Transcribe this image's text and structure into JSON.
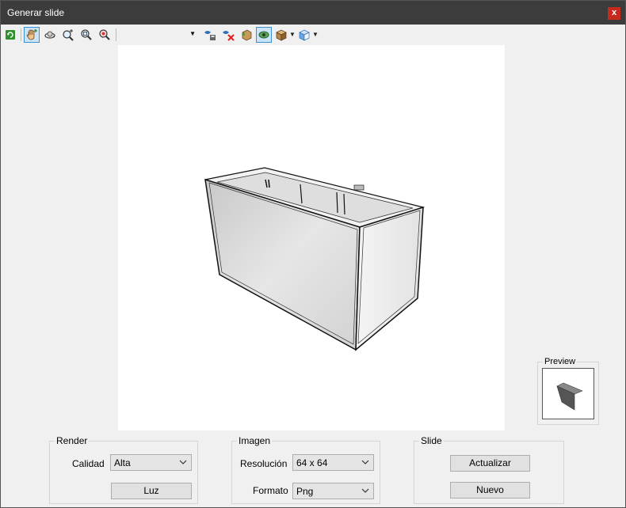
{
  "window": {
    "title": "Generar slide",
    "close_label": "x"
  },
  "toolbar": {
    "view_combo_value": "",
    "icons": [
      "refresh-icon",
      "pan-hand-icon",
      "orbit-icon",
      "zoom-in-icon",
      "zoom-window-icon",
      "zoom-extents-icon",
      "save-view-icon",
      "delete-view-icon",
      "shading-icon",
      "hidden-line-icon",
      "render-style-icon",
      "view-direction-icon"
    ]
  },
  "preview": {
    "label": "Preview"
  },
  "render": {
    "legend": "Render",
    "quality_label": "Calidad",
    "quality_value": "Alta",
    "light_button": "Luz"
  },
  "image": {
    "legend": "Imagen",
    "resolution_label": "Resolución",
    "resolution_value": "64 x 64",
    "format_label": "Formato",
    "format_value": "Png"
  },
  "slide": {
    "legend": "Slide",
    "update_button": "Actualizar",
    "new_button": "Nuevo"
  },
  "colors": {
    "titlebar": "#3c3c3c",
    "close": "#c42b1c",
    "viewport": "#ffffff",
    "cabinet": "#d9d9d9"
  }
}
